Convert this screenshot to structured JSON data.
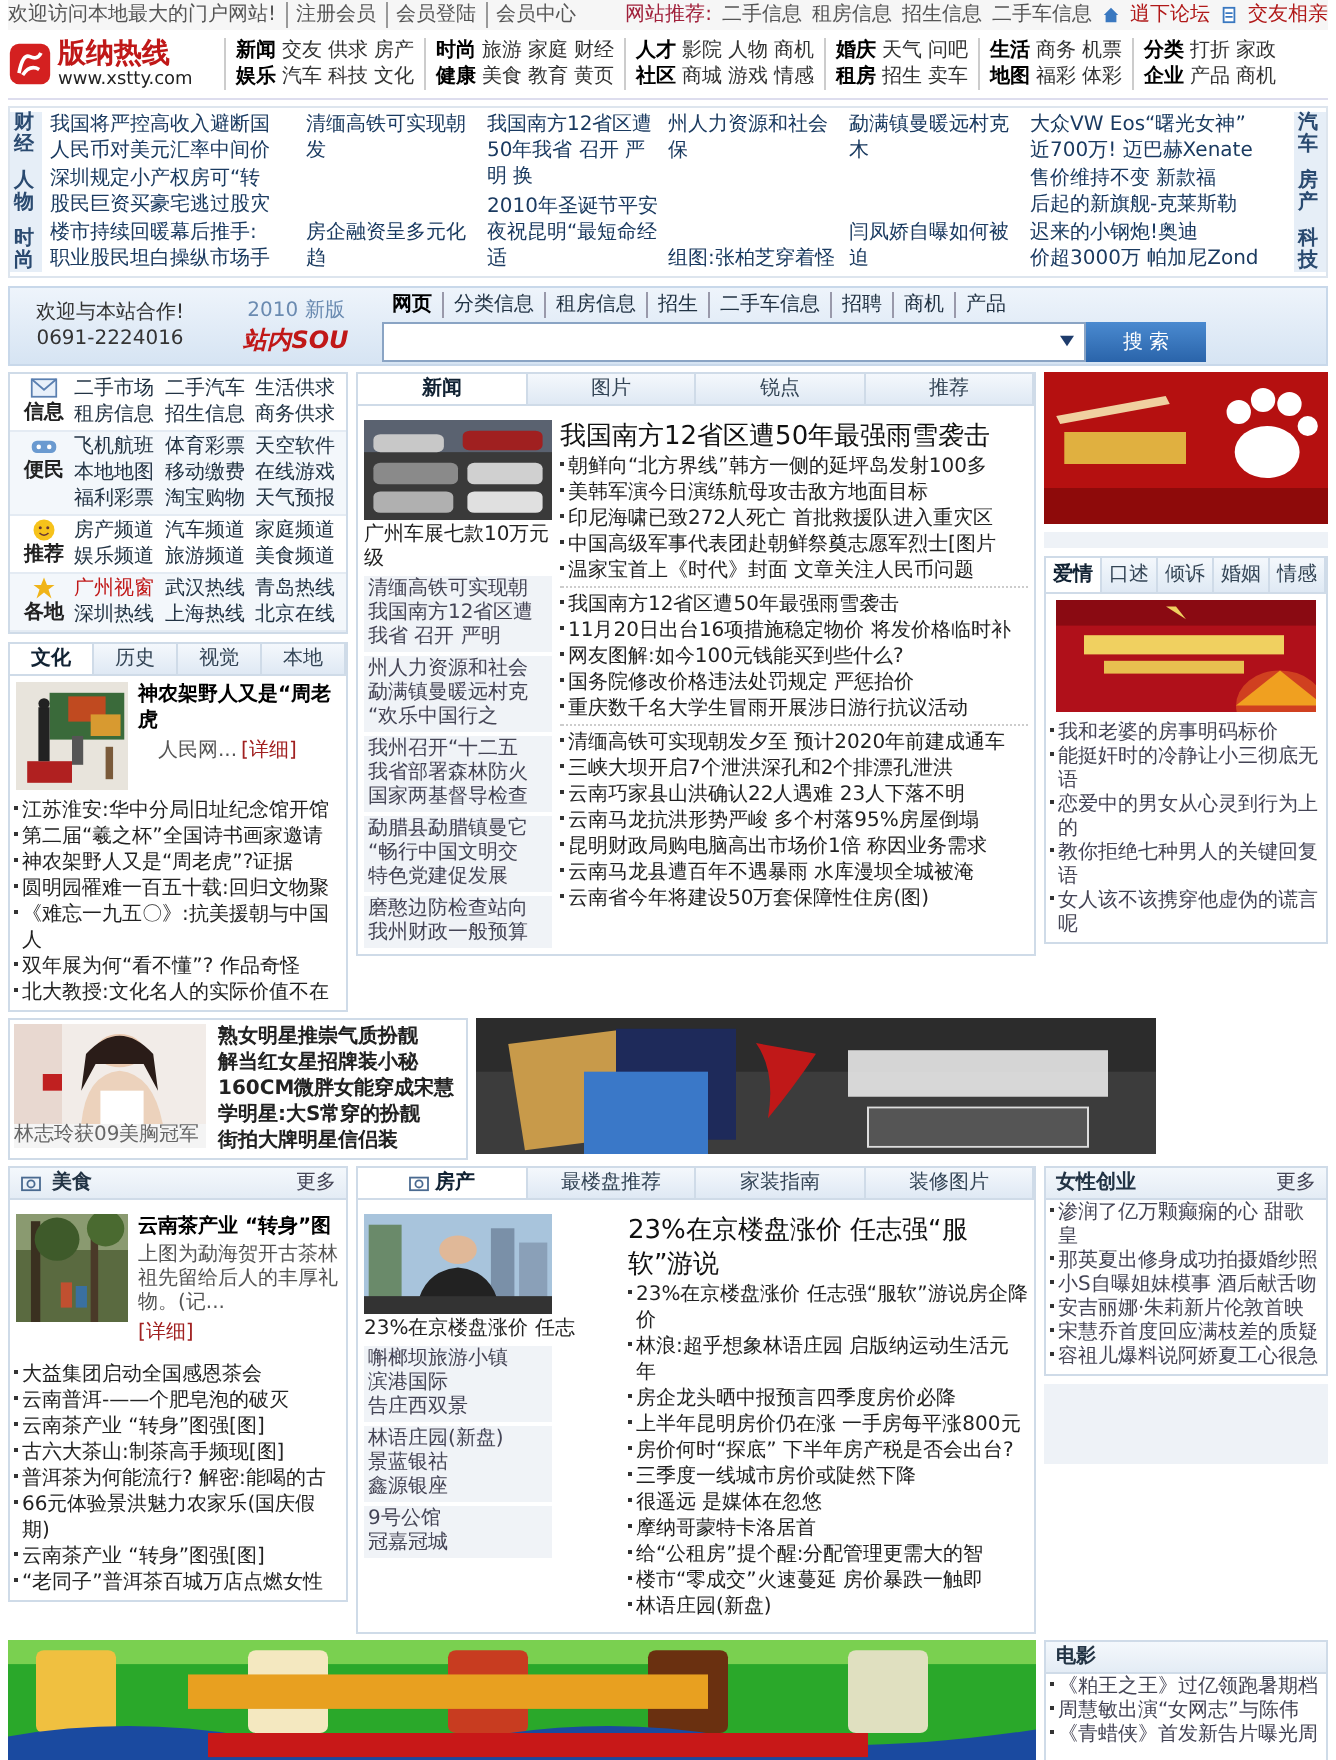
{
  "top_bar": {
    "greeting": "欢迎访问本地最大的门户网站!",
    "member_links": [
      "注册会员",
      "会员登陆",
      "会员中心"
    ],
    "recommend_label": "网站推荐:",
    "recommend_links": [
      "二手信息",
      "租房信息",
      "招生信息",
      "二手车信息"
    ],
    "forum_link": "逍下论坛",
    "dating_link": "交友相亲"
  },
  "header": {
    "logo": "版纳热线",
    "url": "www.xstty.com",
    "nav_groups": [
      {
        "rows": [
          [
            "新闻",
            "交友",
            "供求",
            "房产"
          ],
          [
            "娱乐",
            "汽车",
            "科技",
            "文化"
          ]
        ]
      },
      {
        "rows": [
          [
            "时尚",
            "旅游",
            "家庭",
            "财经"
          ],
          [
            "健康",
            "美食",
            "教育",
            "黄页"
          ]
        ]
      },
      {
        "rows": [
          [
            "人才",
            "影院",
            "人物",
            "商机"
          ],
          [
            "社区",
            "商城",
            "游戏",
            "情感"
          ]
        ]
      },
      {
        "rows": [
          [
            "婚庆",
            "天气",
            "问吧"
          ],
          [
            "租房",
            "招生",
            "卖车"
          ]
        ]
      },
      {
        "rows": [
          [
            "生活",
            "商务",
            "机票"
          ],
          [
            "地图",
            "福彩",
            "体彩"
          ]
        ]
      },
      {
        "rows": [
          [
            "分类",
            "打折",
            "家政"
          ],
          [
            "企业",
            "产品",
            "商机"
          ]
        ]
      }
    ]
  },
  "ticker": {
    "left_tabs": [
      "财经",
      "人物",
      "时尚"
    ],
    "columns": [
      [
        "我国将严控高收入避断国",
        "人民币对美元汇率中间价",
        "深圳规定小产权房可“转",
        "股民巨资买豪宅逃过股灾",
        "楼市持续回暖幕后推手:",
        "职业股民坦白操纵市场手"
      ],
      [
        "清缅高铁可实现朝发",
        "房企融资呈多元化趋"
      ],
      [
        "我国南方12省区遭50年我省 召开 严明 换",
        "2010年圣诞节平安夜祝昆明“最短命经适"
      ],
      [
        "州人力资源和社会保",
        "组图:张柏芝穿着怪"
      ],
      [
        "勐满镇曼暖远村克木",
        "闫凤娇自曝如何被迫"
      ]
    ],
    "right_lines": [
      "大众VW Eos“曙光女神”",
      "近700万! 迈巴赫Xenate",
      "售价维持不变 新款福",
      "后起的新旗舰-克莱斯勒",
      "迟来的小钢炮!奥迪",
      "价超3000万 帕加尼Zond"
    ],
    "right_tabs": [
      "汽车",
      "房产",
      "科技"
    ]
  },
  "search": {
    "welcome": "欢迎与本站合作!",
    "phone": "0691-2224016",
    "version": "2010 新版",
    "logo": "站内SOU",
    "tabs": [
      {
        "label": "网页",
        "selected": true
      },
      {
        "label": "分类信息",
        "selected": false
      },
      {
        "label": "租房信息",
        "selected": false
      },
      {
        "label": "招生",
        "selected": false
      },
      {
        "label": "二手车信息",
        "selected": false
      },
      {
        "label": "招聘",
        "selected": false
      },
      {
        "label": "商机",
        "selected": false
      },
      {
        "label": "产品",
        "selected": false
      }
    ],
    "button": "搜 索"
  },
  "services": [
    {
      "label": "信息",
      "links": [
        {
          "text": "二手市场",
          "highlighted": false
        },
        {
          "text": "二手汽车",
          "highlighted": false
        },
        {
          "text": "生活供求",
          "highlighted": false
        },
        {
          "text": "租房信息",
          "highlighted": false
        },
        {
          "text": "招生信息",
          "highlighted": false
        },
        {
          "text": "商务供求",
          "highlighted": false
        }
      ]
    },
    {
      "label": "便民",
      "links": [
        {
          "text": "飞机航班",
          "highlighted": false
        },
        {
          "text": "体育彩票",
          "highlighted": false
        },
        {
          "text": "天空软件",
          "highlighted": false
        },
        {
          "text": "本地地图",
          "highlighted": false
        },
        {
          "text": "移动缴费",
          "highlighted": false
        },
        {
          "text": "在线游戏",
          "highlighted": false
        },
        {
          "text": "福利彩票",
          "highlighted": false
        },
        {
          "text": "淘宝购物",
          "highlighted": false
        },
        {
          "text": "天气预报",
          "highlighted": false
        }
      ]
    },
    {
      "label": "推荐",
      "links": [
        {
          "text": "房产频道",
          "highlighted": false
        },
        {
          "text": "汽车频道",
          "highlighted": false
        },
        {
          "text": "家庭频道",
          "highlighted": false
        },
        {
          "text": "娱乐频道",
          "highlighted": false
        },
        {
          "text": "旅游频道",
          "highlighted": false
        },
        {
          "text": "美食频道",
          "highlighted": false
        }
      ]
    },
    {
      "label": "各地",
      "links": [
        {
          "text": "广州视窗",
          "highlighted": true
        },
        {
          "text": "武汉热线",
          "highlighted": false
        },
        {
          "text": "青岛热线",
          "highlighted": false
        },
        {
          "text": "深圳热线",
          "highlighted": false
        },
        {
          "text": "上海热线",
          "highlighted": false
        },
        {
          "text": "北京在线",
          "highlighted": false
        }
      ]
    }
  ],
  "news": {
    "tabs": [
      {
        "label": "新闻",
        "selected": true
      },
      {
        "label": "图片",
        "selected": false
      },
      {
        "label": "锐点",
        "selected": false
      },
      {
        "label": "推荐",
        "selected": false
      }
    ],
    "photo_caption": "广州车展七款10万元级",
    "side_boxes": [
      [
        "清缅高铁可实现朝",
        "我国南方12省区遭",
        "我省 召开 严明"
      ],
      [
        "州人力资源和社会",
        "勐满镇曼暖远村克",
        "“欢乐中国行之"
      ],
      [
        "我州召开“十二五",
        "我省部署森林防火",
        "国家两基督导检查"
      ],
      [
        "勐腊县勐腊镇曼它",
        "“畅行中国文明交",
        "特色党建促发展"
      ],
      [
        "磨憨边防检查站向",
        "我州财政一般预算"
      ]
    ],
    "headline": "我国南方12省区遭50年最强雨雪袭击",
    "groups": [
      [
        "朝鲜向“北方界线”韩方一侧的延坪岛发射100多",
        "美韩军演今日演练航母攻击敌方地面目标",
        "印尼海啸已致272人死亡 首批救援队进入重灾区",
        "中国高级军事代表团赴朝鲜祭奠志愿军烈士[图片",
        "温家宝首上《时代》封面 文章关注人民币问题"
      ],
      [
        "我国南方12省区遭50年最强雨雪袭击",
        "11月20日出台16项措施稳定物价 将发价格临时补",
        "网友图解:如今100元钱能买到些什么?",
        "国务院修改价格违法处罚规定 严惩抬价",
        "重庆数千名大学生冒雨开展涉日游行抗议活动"
      ],
      [
        "清缅高铁可实现朝发夕至 预计2020年前建成通车",
        "三峡大坝开启7个泄洪深孔和2个排漂孔泄洪",
        "云南巧家县山洪确认22人遇难 23人下落不明",
        "云南马龙抗洪形势严峻 多个村落95%房屋倒塌",
        "昆明财政局购电脑高出市场价1倍 称因业务需求",
        "云南马龙县遭百年不遇暴雨 水库漫坝全城被淹",
        "云南省今年将建设50万套保障性住房(图)"
      ]
    ]
  },
  "culture": {
    "tabs": [
      {
        "label": "文化",
        "selected": true
      },
      {
        "label": "历史",
        "selected": false
      },
      {
        "label": "视觉",
        "selected": false
      },
      {
        "label": "本地",
        "selected": false
      }
    ],
    "title": "神农架野人又是“周老虎",
    "source": "人民网...",
    "more": "[详细]",
    "items": [
      "江苏淮安:华中分局旧址纪念馆开馆",
      "第二届“羲之杯”全国诗书画家邀请",
      "神农架野人又是“周老虎”?证据",
      "圆明园罹难一百五十载:回归文物聚",
      "《难忘一九五〇》:抗美援朝与中国人",
      "双年展为何“看不懂”? 作品奇怪",
      "北大教授:文化名人的实际价值不在"
    ]
  },
  "emotion": {
    "tabs": [
      {
        "label": "爱情",
        "selected": true
      },
      {
        "label": "口述",
        "selected": false
      },
      {
        "label": "倾诉",
        "selected": false
      },
      {
        "label": "婚姻",
        "selected": false
      },
      {
        "label": "情感",
        "selected": false
      }
    ],
    "items": [
      "我和老婆的房事明码标价",
      "能挺奸时的冷静让小三彻底无语",
      "恋爱中的男女从心灵到行为上的",
      "教你拒绝七种男人的关键回复语",
      "女人该不该携穿他虚伪的谎言呢"
    ]
  },
  "star": {
    "caption": "林志玲获09美胸冠军",
    "items": [
      "熟女明星推崇气质扮靓",
      "解当红女星招牌装小秘",
      "160CM微胖女能穿成宋慧",
      "学明星:大S常穿的扮靓",
      "街拍大牌明星信侣装"
    ]
  },
  "food": {
    "title": "美食",
    "more": "更多",
    "feature": {
      "title": "云南茶产业 “转身”图",
      "desc": "上图为勐海贺开古茶林祖先留给后人的丰厚礼物。(记...",
      "more": "[详细]"
    },
    "items": [
      "大益集团启动全国感恩茶会",
      "云南普洱-——个肥皂泡的破灭",
      "云南茶产业 “转身”图强[图]",
      "古六大茶山:制茶高手频现[图]",
      "普洱茶为何能流行? 解密:能喝的古",
      "66元体验景洪魅力农家乐(国庆假期)",
      "云南茶产业 “转身”图强[图]",
      "“老同子”普洱茶百城万店点燃女性"
    ]
  },
  "house": {
    "tabs": [
      {
        "label": "房产",
        "selected": true
      },
      {
        "label": "最楼盘推荐",
        "selected": false
      },
      {
        "label": "家装指南",
        "selected": false
      },
      {
        "label": "装修图片",
        "selected": false
      }
    ],
    "photo_caption": "23%在京楼盘涨价 任志",
    "side_groups": [
      [
        "嘝榔坝旅游小镇",
        "滨港国际",
        "告庄西双景"
      ],
      [
        "林语庄园(新盘)",
        "景蓝银祜",
        "鑫源银座"
      ],
      [
        "9号公馆",
        "冠嘉冠城"
      ]
    ],
    "headline": "23%在京楼盘涨价 任志强“服软”游说",
    "items": [
      "23%在京楼盘涨价 任志强“服软”游说房企降价",
      "林浪:超乎想象林语庄园 启版纳运动生活元年",
      "房企龙头晒中报预言四季度房价必降",
      "上半年昆明房价仍在涨 一手房每平涨800元",
      "房价何时“探底” 下半年房产税是否会出台?",
      "三季度一线城市房价或陡然下降",
      "很遥远 是媒体在忽悠",
      "摩纳哥蒙特卡洛居首",
      "给“公租房”提个醒:分配管理更需大的智",
      "楼市“零成交”火速蔓延 房价暴跌一触即",
      "林语庄园(新盘)"
    ]
  },
  "women": {
    "title": "女性创业",
    "more": "更多",
    "items": [
      "渗润了亿万颗癫痫的心 甜歌皇",
      "那英夏出修身成功拍摄婚纱照",
      "小S自曝姐妹模事 酒后献舌吻",
      "安吉丽娜·朱莉新片伦敦首映",
      "宋慧乔首度回应满枝差的质疑",
      "容祖儿爆料说阿娇夏工心很急"
    ]
  },
  "movie": {
    "title": "电影",
    "items": [
      "《粕王之王》过亿领跑暑期档",
      "周慧敏出演“女网志”与陈伟",
      "《青蜡侠》首发新告片曝光周"
    ]
  }
}
